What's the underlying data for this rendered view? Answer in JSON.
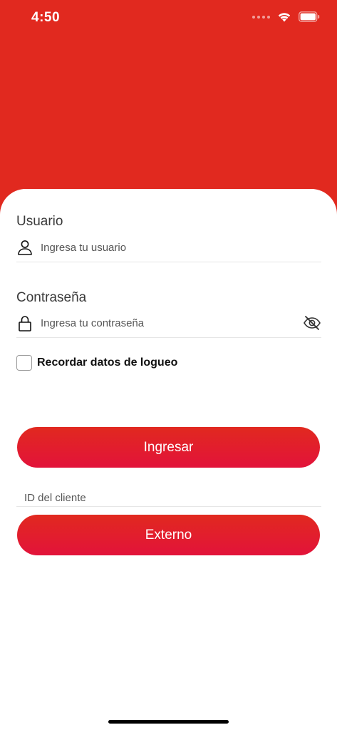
{
  "status_bar": {
    "time": "4:50"
  },
  "login": {
    "user_label": "Usuario",
    "user_placeholder": "Ingresa tu usuario",
    "password_label": "Contraseña",
    "password_placeholder": "Ingresa tu contraseña",
    "remember_label": "Recordar datos de logueo",
    "remember_checked": false,
    "login_button": "Ingresar",
    "client_id_placeholder": "ID del cliente",
    "external_button": "Externo"
  },
  "icons": {
    "user_field": "user-icon",
    "password_field": "lock-icon",
    "password_toggle": "eye-slash-icon"
  },
  "colors": {
    "header_red": "#E1291F",
    "button_gradient_top": "#E1291F",
    "button_gradient_bottom": "#E2133A",
    "card_background": "#FFFFFF"
  }
}
